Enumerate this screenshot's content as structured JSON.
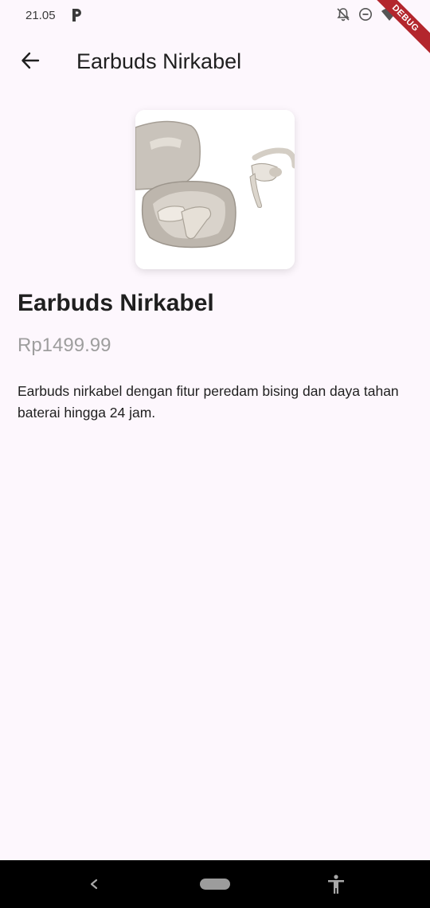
{
  "status_bar": {
    "time": "21.05",
    "icons": [
      "p-app-icon",
      "notifications-off-icon",
      "do-not-disturb-icon",
      "wifi-icon"
    ]
  },
  "debug_banner": {
    "label": "DEBUG"
  },
  "app_bar": {
    "title": "Earbuds Nirkabel",
    "back_icon": "arrow-back-icon"
  },
  "product": {
    "image_subject": "earbuds-product-image",
    "name": "Earbuds Nirkabel",
    "price": "Rp1499.99",
    "description": "Earbuds nirkabel dengan fitur peredam bising dan daya tahan baterai hingga 24 jam."
  },
  "nav_bar": {
    "icons": [
      "nav-back-icon",
      "nav-home-pill",
      "accessibility-icon"
    ]
  },
  "colors": {
    "background": "#fdf7fd",
    "price": "#9e9e9e",
    "debug_banner": "#b3262d",
    "nav_bar": "#000000"
  }
}
